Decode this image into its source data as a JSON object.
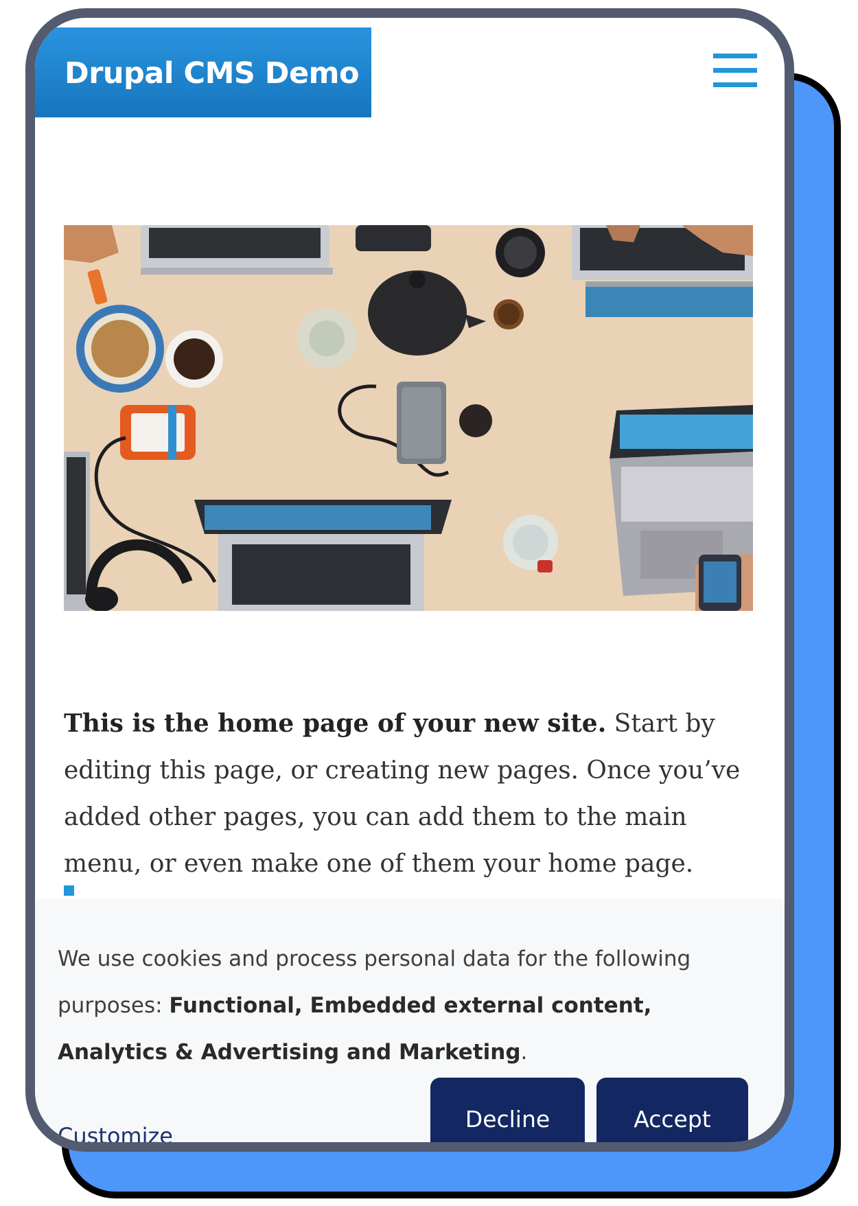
{
  "header": {
    "site_name": "Drupal CMS Demo",
    "menu_icon": "hamburger-menu-icon"
  },
  "hero": {
    "icon": "hero-photo"
  },
  "intro": {
    "bold": "This is the home page of your new site.",
    "text": " Start by editing this page, or creating new pages. Once you’ve added other pages, you can add them to the main menu, or even make one of them your home page."
  },
  "cookie_banner": {
    "text_before": "We use cookies and process personal data for the following purposes: ",
    "purposes": "Functional, Embedded external content, Analytics & Advertising and Marketing",
    "text_after": ".",
    "customize_label": "Customize",
    "decline_label": "Decline",
    "accept_label": "Accept"
  },
  "colors": {
    "brand_blue": "#1b83cf",
    "button_navy": "#132862",
    "frame_blue": "#4d97fa"
  }
}
